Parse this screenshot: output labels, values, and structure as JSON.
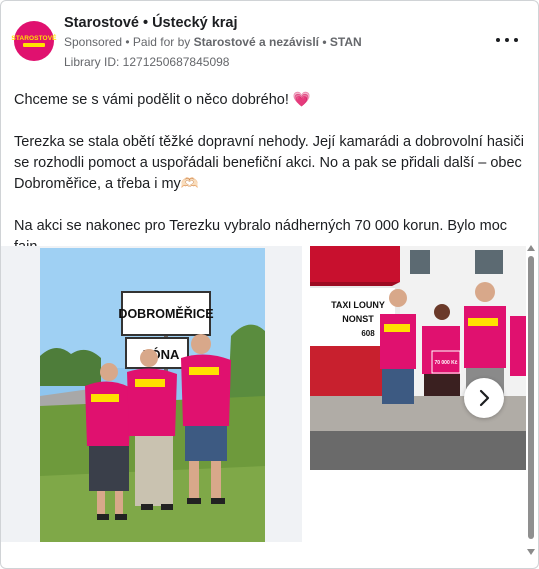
{
  "post": {
    "page_name": "Starostové • Ústecký kraj",
    "sponsored": "Sponsored",
    "paid_for_prefix": " • Paid for by ",
    "paid_for_name": "Starostové a nezávislí • STAN",
    "library_id": "Library ID: 1271250687845098",
    "avatar_logo_text": "STAROSTOVÉ",
    "more_icon": "more-horizontal-icon",
    "text_lines": [
      "Chceme se s vámi podělit o něco dobrého! ",
      "Terezka se stala obětí těžké dopravní nehody. Její kamarádi a dobrovolní hasiči se rozhodli pomoct a uspořádali benefiční akci. No a pak se přidali další – obec Dobroměřice, a třeba i my",
      "Na akci se nakonec pro Terezku vybralo nádherných 70 000 korun. Bylo moc fajn…"
    ],
    "heart_emoji": "💗",
    "hands_emoji": "🫶🏻"
  },
  "carousel": {
    "slide1": {
      "sign_top": "DOBROMĚŘICE",
      "sign_bottom": "ZÓNA",
      "shirt_text": "STAROSTOVÉ"
    },
    "slide2": {
      "banner_text": "TAXI LOUNY",
      "banner_phone": "NONST",
      "banner_digits": "608",
      "check_text": "70 000 Kč",
      "shirt_text": "STAROSTOVÉ"
    },
    "next_icon": "chevron-right-icon"
  },
  "colors": {
    "brand_pink": "#e0116f",
    "brand_yellow": "#ffe100",
    "text_secondary": "#65676b"
  }
}
